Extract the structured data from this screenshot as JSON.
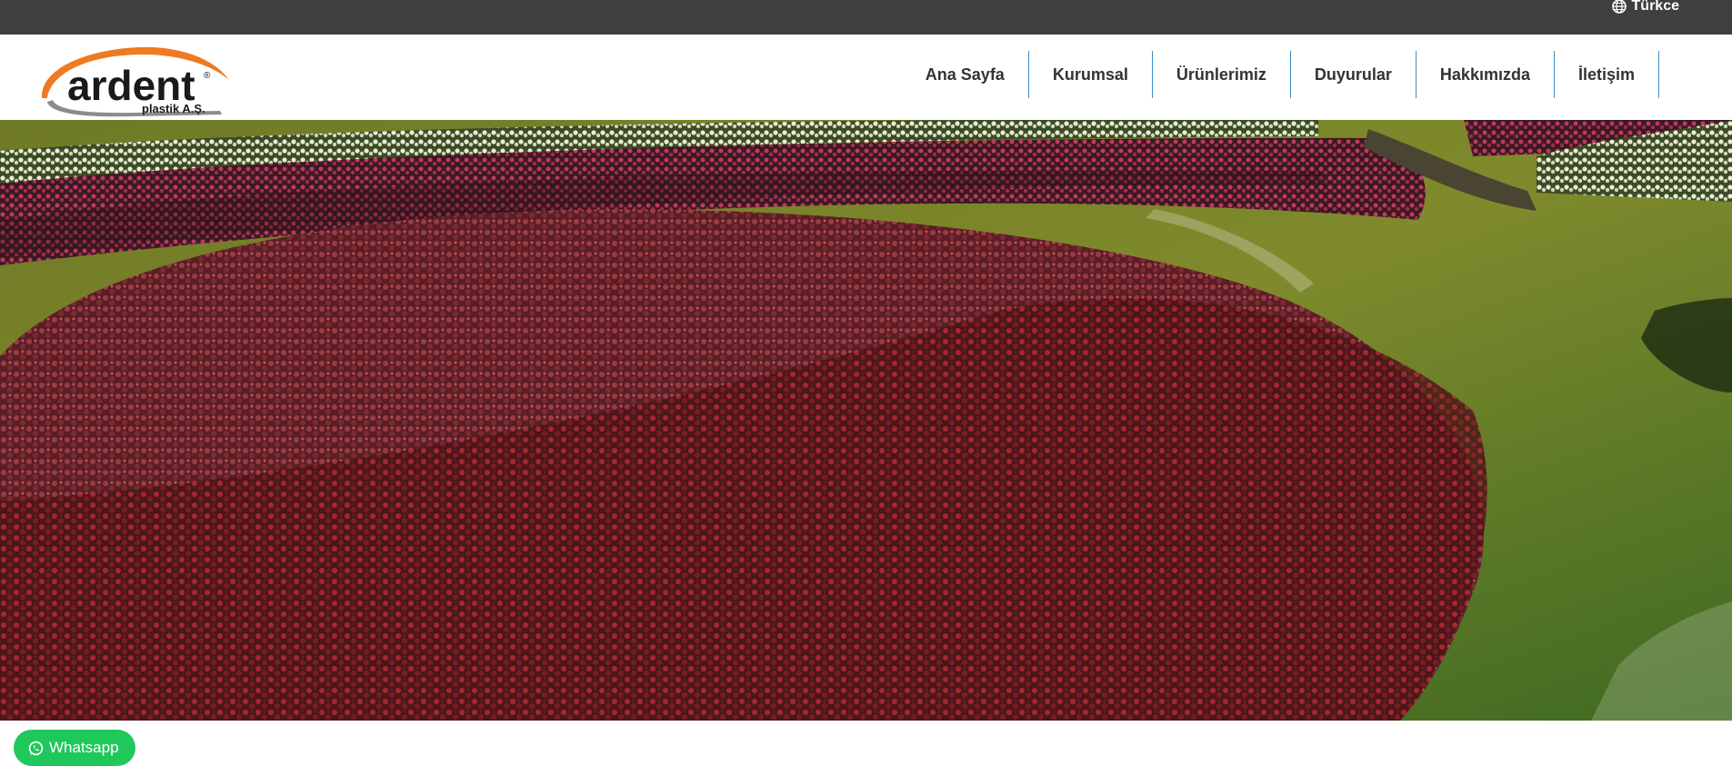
{
  "topbar": {
    "language_label": "Türkce",
    "language_icon": "globe-icon"
  },
  "brand": {
    "name": "ardent",
    "subtitle": "plastik A.Ş.",
    "mark": "®",
    "accent_color": "#ef7a22"
  },
  "nav": {
    "items": [
      {
        "label": "Ana Sayfa"
      },
      {
        "label": "Kurumsal"
      },
      {
        "label": "Ürünlerimiz"
      },
      {
        "label": "Duyurular"
      },
      {
        "label": "Hakkımızda"
      },
      {
        "label": "İletişim"
      }
    ],
    "divider_color": "#3a8dc9"
  },
  "hero": {
    "image_icon": "tulip-field-image"
  },
  "whatsapp": {
    "label": "Whatsapp",
    "icon": "whatsapp-icon",
    "color": "#1fc85a"
  }
}
